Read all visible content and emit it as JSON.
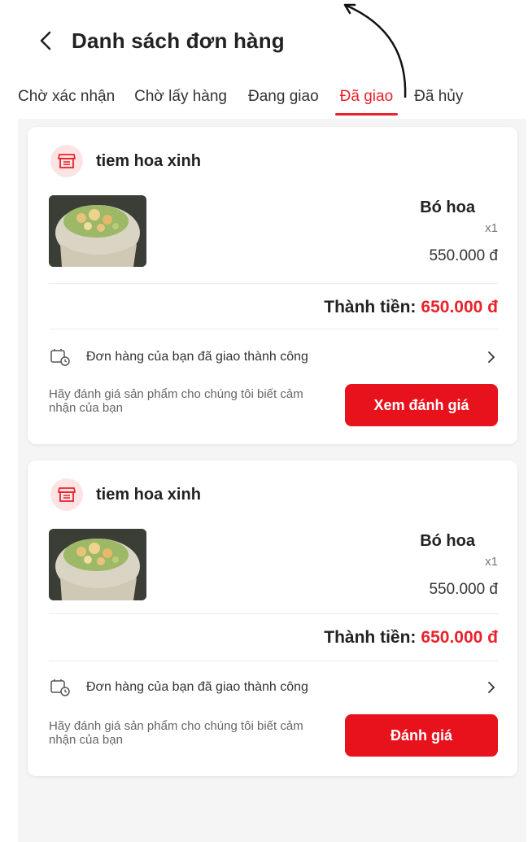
{
  "header": {
    "title": "Danh sách đơn hàng",
    "back_icon": "chevron-left-icon"
  },
  "tabs": [
    {
      "label": "Chờ xác nhận",
      "active": false
    },
    {
      "label": "Chờ lấy hàng",
      "active": false
    },
    {
      "label": "Đang giao",
      "active": false
    },
    {
      "label": "Đã giao",
      "active": true
    },
    {
      "label": "Đã hủy",
      "active": false
    }
  ],
  "orders": [
    {
      "shop_name": "tiem hoa xinh",
      "product_name": "Bó hoa",
      "quantity": "x1",
      "price": "550.000 đ",
      "total_label": "Thành tiền:",
      "total_value": "650.000 đ",
      "status": "Đơn hàng của bạn đã giao thành công",
      "review_prompt": "Hãy đánh giá sản phẩm cho chúng tôi biết cảm nhận của bạn",
      "button_label": "Xem đánh giá"
    },
    {
      "shop_name": "tiem hoa xinh",
      "product_name": "Bó hoa",
      "quantity": "x1",
      "price": "550.000 đ",
      "total_label": "Thành tiền:",
      "total_value": "650.000 đ",
      "status": "Đơn hàng của bạn đã giao thành công",
      "review_prompt": "Hãy đánh giá sản phẩm cho chúng tôi biết cảm nhận của bạn",
      "button_label": "Đánh giá"
    }
  ],
  "colors": {
    "accent": "#e8232b",
    "button": "#e8121d",
    "shop_icon_bg": "#fde4e4"
  }
}
